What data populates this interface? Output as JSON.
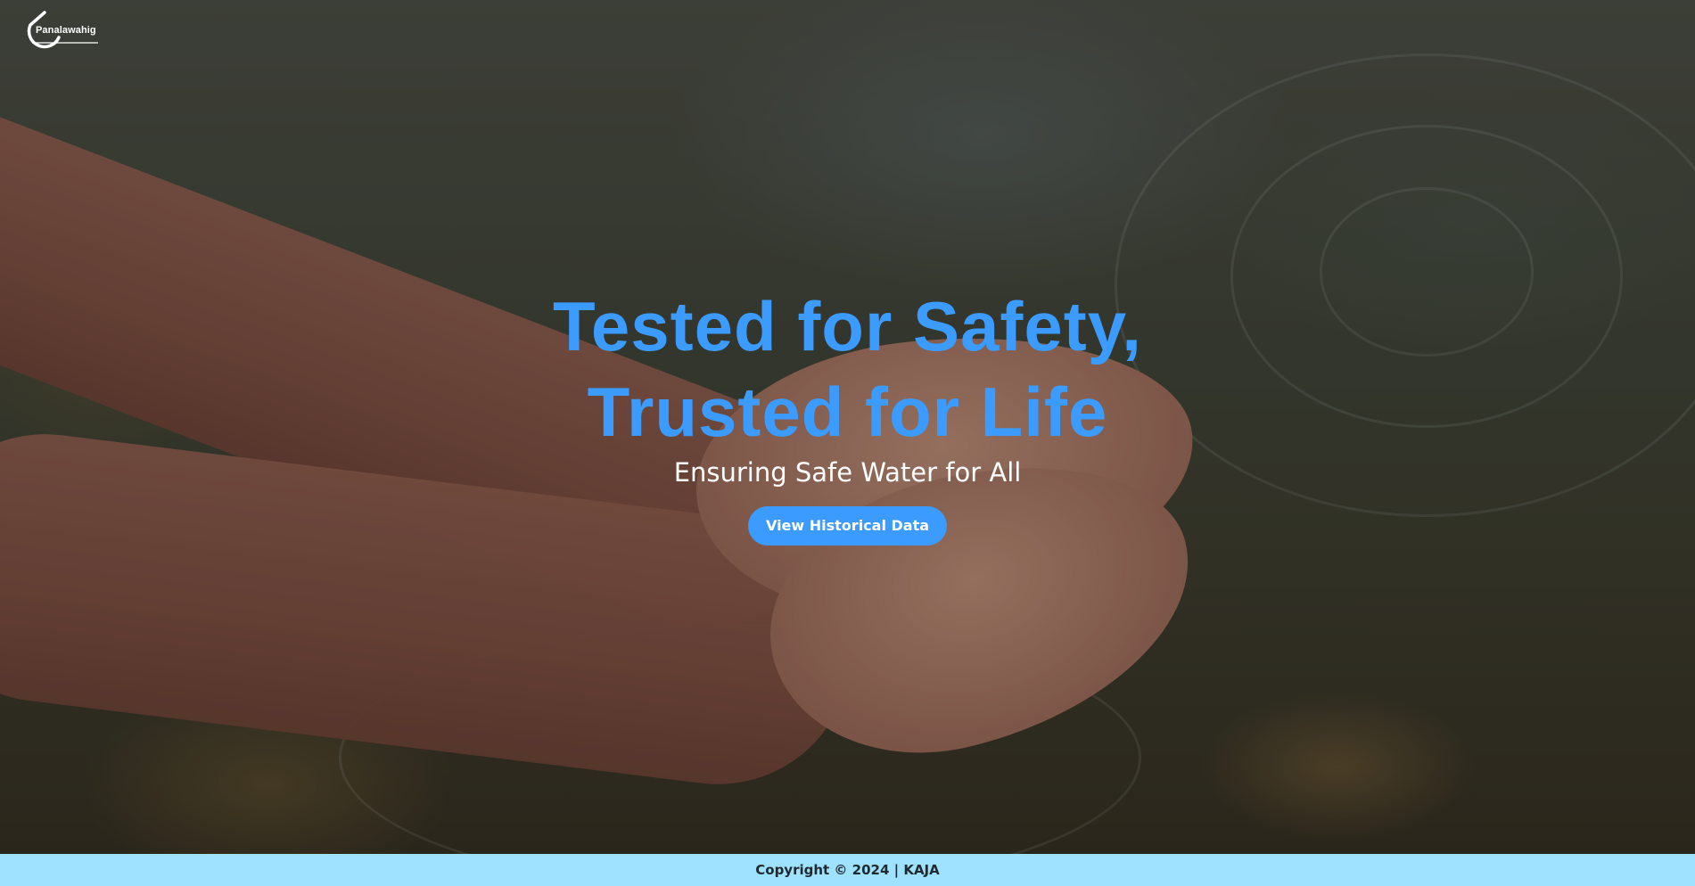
{
  "brand": {
    "name": "Panalawahig",
    "logo_icon": "drop-outline-icon"
  },
  "hero": {
    "headline_line1": "Tested for Safety,",
    "headline_line2": "Trusted for Life",
    "subtitle": "Ensuring Safe Water for All",
    "cta_label": "View Historical Data"
  },
  "footer": {
    "copyright": "Copyright © 2024 | KAJA"
  },
  "colors": {
    "accent": "#3c9bff",
    "footer_bg": "#9fe2ff",
    "headline": "#3c9bff"
  }
}
